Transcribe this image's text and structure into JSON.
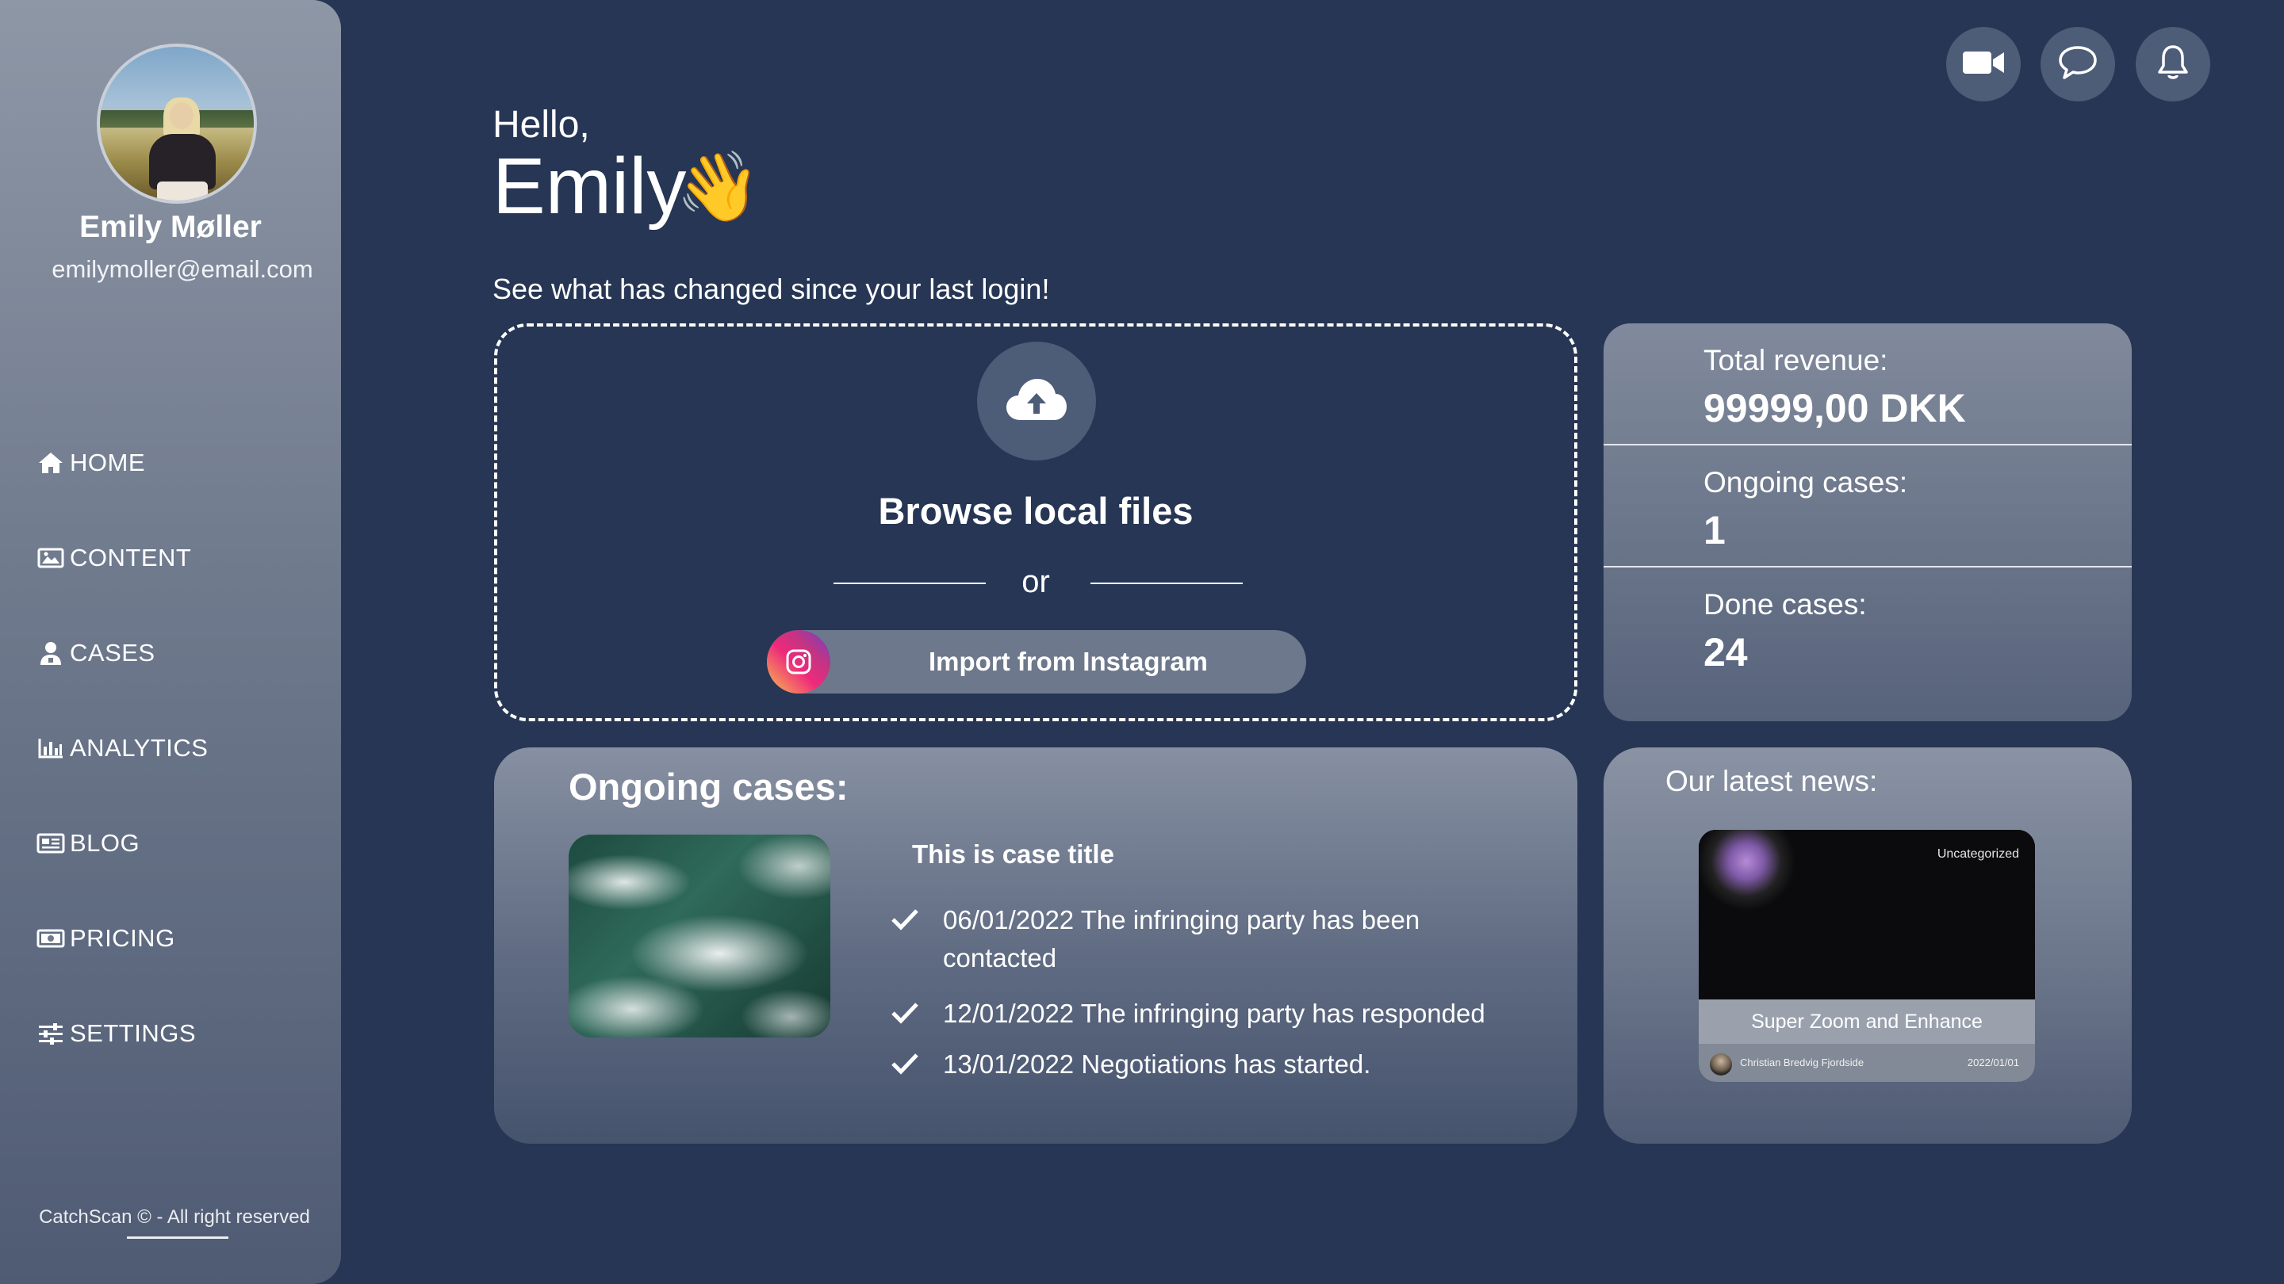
{
  "profile": {
    "name": "Emily Møller",
    "email": "emilymoller@email.com"
  },
  "nav": {
    "items": [
      {
        "label": "HOME",
        "icon": "home-icon"
      },
      {
        "label": "CONTENT",
        "icon": "image-icon"
      },
      {
        "label": "CASES",
        "icon": "user-icon"
      },
      {
        "label": "ANALYTICS",
        "icon": "bar-chart-icon"
      },
      {
        "label": "BLOG",
        "icon": "newspaper-icon"
      },
      {
        "label": "PRICING",
        "icon": "money-icon"
      },
      {
        "label": "SETTINGS",
        "icon": "sliders-icon"
      }
    ]
  },
  "footer": {
    "text": "CatchScan © - All right reserved"
  },
  "topbar": {
    "icons": [
      "video-camera-icon",
      "chat-icon",
      "bell-icon"
    ]
  },
  "greeting": {
    "hello": "Hello,",
    "name": "Emily",
    "emoji": "👋",
    "subtitle": "See what has changed since your last login!"
  },
  "upload": {
    "browse_label": "Browse local files",
    "or_label": "or",
    "instagram_label": "Import from Instagram",
    "icon": "cloud-upload-icon"
  },
  "stats": [
    {
      "label": "Total revenue:",
      "value": "99999,00 DKK"
    },
    {
      "label": "Ongoing cases:",
      "value": "1"
    },
    {
      "label": "Done cases:",
      "value": "24"
    }
  ],
  "cases": {
    "title": "Ongoing cases:",
    "case_title": "This is case title",
    "events": [
      "06/01/2022 The infringing party has been contacted",
      "12/01/2022 The infringing party has responded",
      "13/01/2022 Negotiations has started."
    ]
  },
  "news": {
    "title": "Our latest news:",
    "tag": "Uncategorized",
    "headline": "Super Zoom and Enhance",
    "author": "Christian Bredvig Fjordside",
    "date": "2022/01/01"
  },
  "colors": {
    "background": "#263654",
    "card": "#6c778b",
    "button": "#4d5c77"
  }
}
